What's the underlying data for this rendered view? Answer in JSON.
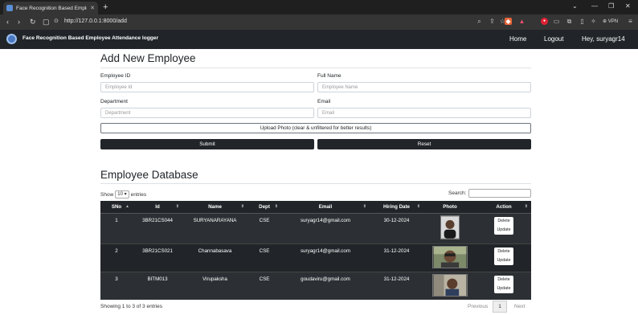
{
  "browser": {
    "tab_title": "Face Recognition Based Employ",
    "url": "http://127.0.0.1:8000/add",
    "vpn_label": "VPN"
  },
  "navbar": {
    "brand": "Face Recognition Based Employee Attendance logger",
    "home": "Home",
    "logout": "Logout",
    "greeting": "Hey, suryagr14"
  },
  "form": {
    "title": "Add New Employee",
    "employee_id": {
      "label": "Employee ID",
      "placeholder": "Employee Id"
    },
    "full_name": {
      "label": "Full Name",
      "placeholder": "Employee Name"
    },
    "department": {
      "label": "Department",
      "placeholder": "Department"
    },
    "email": {
      "label": "Email",
      "placeholder": "Email"
    },
    "upload_label": "Upload Photo (clear & unfiltered for better results)",
    "submit_label": "Submit",
    "reset_label": "Reset"
  },
  "database": {
    "title": "Employee Database",
    "show_prefix": "Show",
    "entries_value": "10",
    "entries_suffix": "entries",
    "search_label": "Search:",
    "columns": [
      "SNo",
      "Id",
      "Name",
      "Dept",
      "Email",
      "Hiring Date",
      "Photo",
      "Action"
    ],
    "rows": [
      {
        "sno": "1",
        "id": "3BR21CS044",
        "name": "SURYANARAYANA",
        "dept": "CSE",
        "email": "suryagr14@gmail.com",
        "date": "30-12-2024"
      },
      {
        "sno": "2",
        "id": "3BR21CS021",
        "name": "Channabasava",
        "dept": "CSE",
        "email": "suryagr14@gmail.com",
        "date": "31-12-2024"
      },
      {
        "sno": "3",
        "id": "BITM013",
        "name": "Virupaksha",
        "dept": "CSE",
        "email": "goudaviru@gmail.com",
        "date": "31-12-2024"
      }
    ],
    "delete_label": "Delete",
    "update_label": "Update",
    "info": "Showing 1 to 3 of 3 entries",
    "previous": "Previous",
    "current_page": "1",
    "next": "Next"
  }
}
